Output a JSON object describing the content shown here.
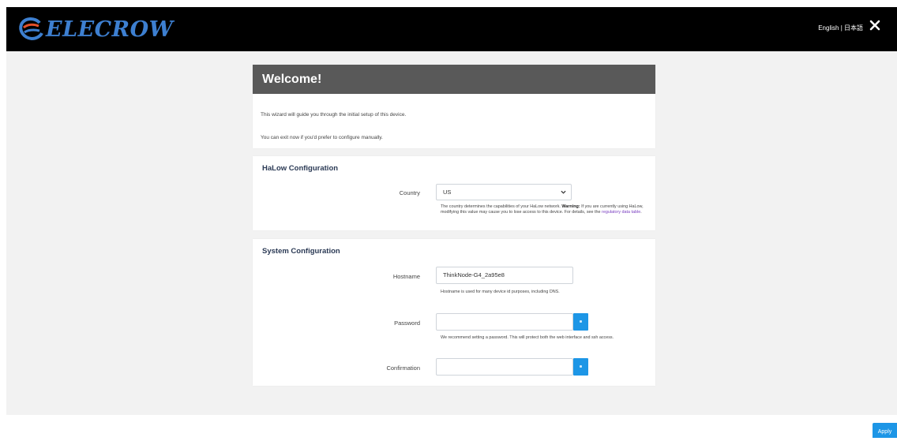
{
  "header": {
    "brand": "ELECROW",
    "lang_english": "English",
    "lang_sep": " | ",
    "lang_japanese": "日本語"
  },
  "welcome": {
    "title": "Welcome!",
    "line1": "This wizard will guide you through the initial setup of this device.",
    "line2": "You can exit now if you'd prefer to configure manually."
  },
  "halow": {
    "title": "HaLow Configuration",
    "country_label": "Country",
    "country_value": "US",
    "help_pre": "The country determines the capabilities of your HaLow network. ",
    "help_warning": "Warning:",
    "help_mid": " If you are currently using HaLow, modifying this value may cause you to lose access to this device. For details, see the ",
    "help_link": "regulatory data table",
    "help_end": "."
  },
  "system": {
    "title": "System Configuration",
    "hostname_label": "Hostname",
    "hostname_value": "ThinkNode-G4_2a95e8",
    "hostname_help": "Hostname is used for many device id purposes, including DNS.",
    "password_label": "Password",
    "password_value": "",
    "password_help": "We recommend setting a password. This will protect both the web interface and ssh access.",
    "confirmation_label": "Confirmation",
    "confirmation_value": ""
  },
  "actions": {
    "apply_label": "Apply"
  },
  "colors": {
    "accent": "#1d96e6",
    "header_bg": "#000000",
    "welcome_bg": "#595959",
    "link": "#7a3fc0"
  }
}
